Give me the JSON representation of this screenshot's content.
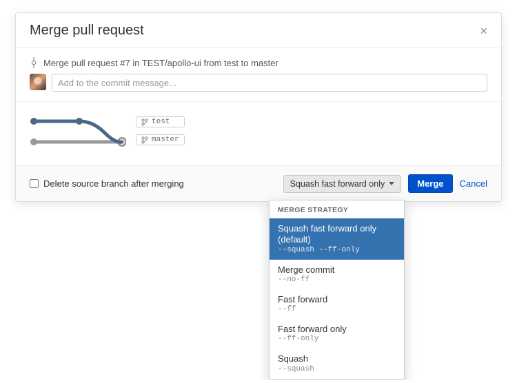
{
  "dialog": {
    "title": "Merge pull request",
    "close": "×"
  },
  "commit": {
    "text": "Merge pull request #7 in TEST/apollo-ui from test to master"
  },
  "message": {
    "placeholder": "Add to the commit message..."
  },
  "branches": {
    "source": "test",
    "target": "master"
  },
  "footer": {
    "delete_label": "Delete source branch after merging",
    "strategy_button": "Squash fast forward only",
    "merge": "Merge",
    "cancel": "Cancel"
  },
  "dropdown": {
    "header": "MERGE STRATEGY",
    "selected_index": 0,
    "items": [
      {
        "label": "Squash fast forward only (default)",
        "cmd": "--squash --ff-only"
      },
      {
        "label": "Merge commit",
        "cmd": "--no-ff"
      },
      {
        "label": "Fast forward",
        "cmd": "--ff"
      },
      {
        "label": "Fast forward only",
        "cmd": "--ff-only"
      },
      {
        "label": "Squash",
        "cmd": "--squash"
      }
    ]
  },
  "colors": {
    "accent": "#0052cc",
    "graph_branch": "#4a6785",
    "graph_base": "#999999"
  }
}
